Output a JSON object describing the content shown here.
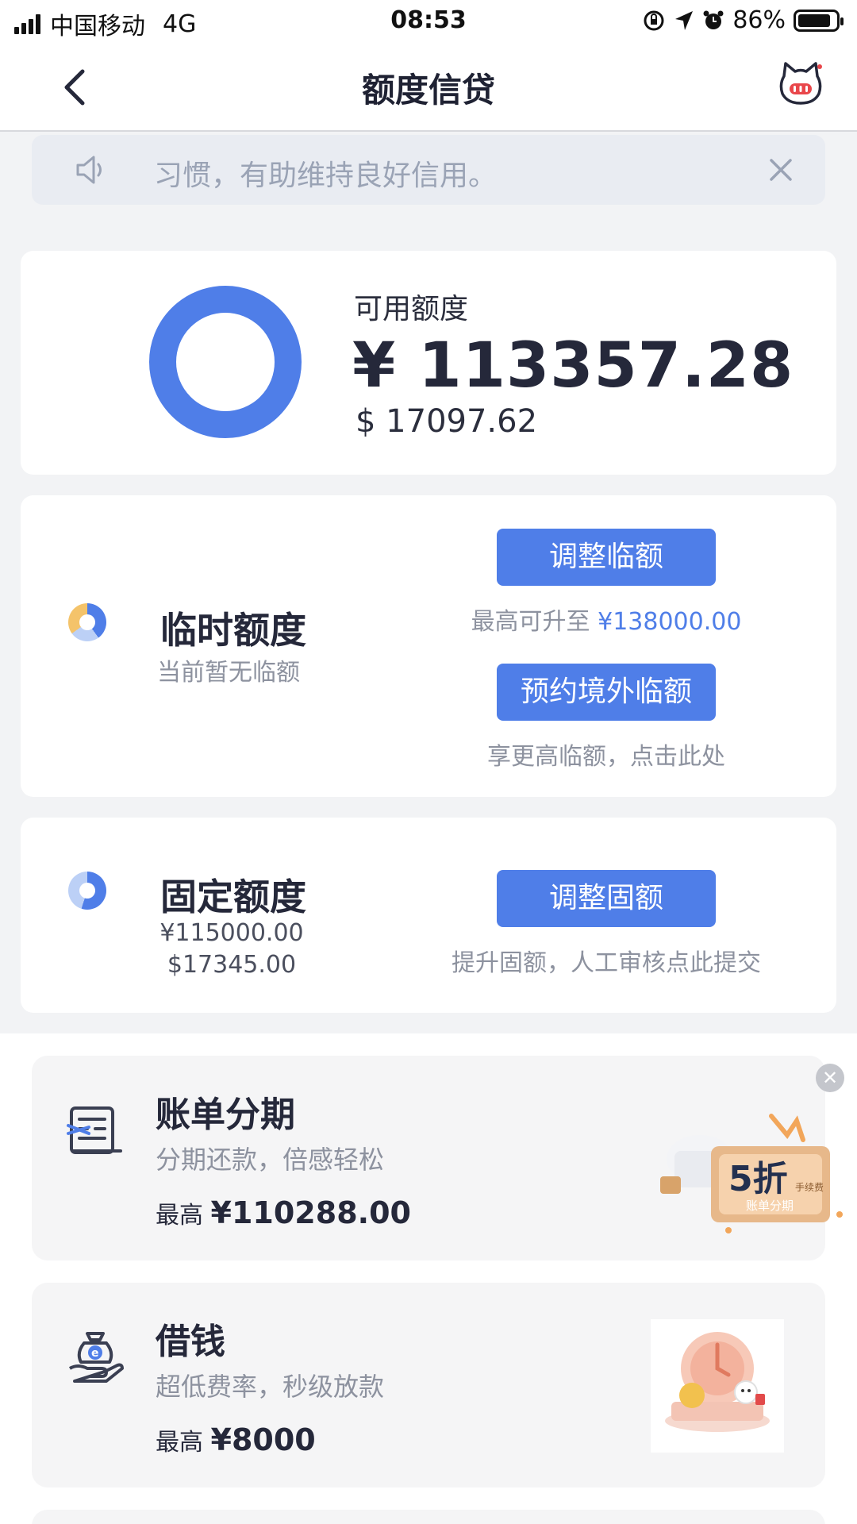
{
  "status_bar": {
    "carrier": "中国移动",
    "network": "4G",
    "time": "08:53",
    "battery": "86%",
    "battery_level": 0.86
  },
  "nav": {
    "title": "额度信贷",
    "back_icon": "chevron-left-icon",
    "mascot_icon": "cat-mascot-icon"
  },
  "notice": {
    "text": "习惯，有助维持良好信用。",
    "icon": "speaker-icon"
  },
  "available": {
    "label": "可用额度",
    "cny": "¥ 113357.28",
    "usd": "$ 17097.62",
    "ring_color": "#4f7ee8"
  },
  "temp_limit": {
    "title": "临时额度",
    "subtitle": "当前暂无临额",
    "adjust_button": "调整临额",
    "adjust_note_prefix": "最高可升至 ",
    "adjust_note_amount": "¥138000.00",
    "overseas_button": "预约境外临额",
    "overseas_note": "享更高临额，点击此处"
  },
  "fixed_limit": {
    "title": "固定额度",
    "cny": "¥115000.00",
    "usd": "$17345.00",
    "adjust_button": "调整固额",
    "adjust_note": "提升固额，人工审核点此提交"
  },
  "promos": [
    {
      "title": "账单分期",
      "subtitle": "分期还款，倍感轻松",
      "max_prefix": "最高 ",
      "max_amount": "¥110288.00",
      "icon": "bill-installment-icon",
      "badge": {
        "big": "5折",
        "small": "手续费",
        "caption": "账单分期"
      }
    },
    {
      "title": "借钱",
      "subtitle": "超低费率，秒级放款",
      "max_prefix": "最高 ",
      "max_amount": "¥8000",
      "icon": "money-bag-hand-icon"
    }
  ],
  "colors": {
    "accent": "#4f7ee8",
    "background": "#f2f3f5",
    "text_primary": "#25283a",
    "text_secondary": "#8d929f"
  }
}
